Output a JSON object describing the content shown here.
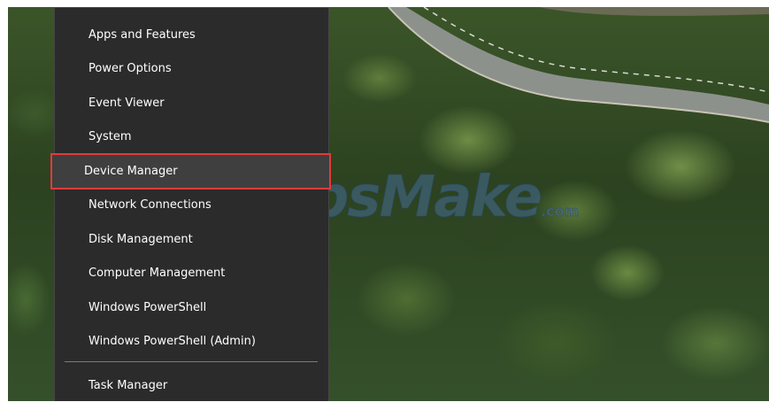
{
  "context_menu": {
    "items": [
      {
        "label": "Apps and Features"
      },
      {
        "label": "Power Options"
      },
      {
        "label": "Event Viewer"
      },
      {
        "label": "System"
      },
      {
        "label": "Device Manager",
        "selected": true
      },
      {
        "label": "Network Connections"
      },
      {
        "label": "Disk Management"
      },
      {
        "label": "Computer Management"
      },
      {
        "label": "Windows PowerShell"
      },
      {
        "label": "Windows PowerShell (Admin)"
      },
      {
        "label": "Task Manager"
      }
    ],
    "colors": {
      "background": "#2b2b2b",
      "text": "#ffffff",
      "highlight_border": "#e23b3b",
      "highlight_background": "#3f3f3f"
    }
  },
  "watermark": {
    "text": "TipsMake",
    "suffix": ".com"
  }
}
